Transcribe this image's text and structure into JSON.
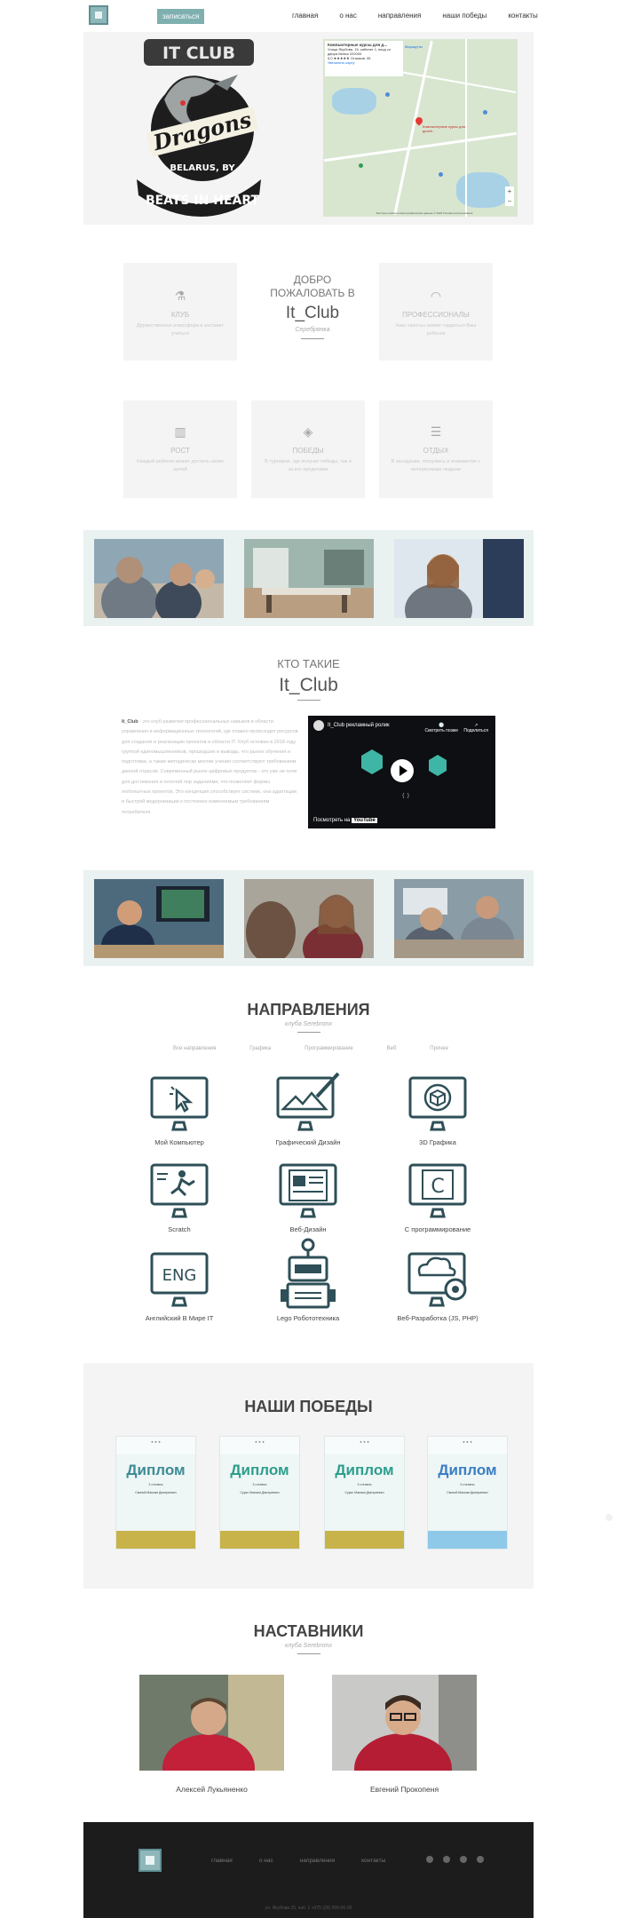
{
  "header": {
    "signup_label": "записаться",
    "nav": [
      "главная",
      "о нас",
      "направления",
      "наши победы",
      "контакты"
    ]
  },
  "badge": {
    "top_text": "IT CLUB",
    "middle_text": "Dragons",
    "country": "BELARUS, BY",
    "bottom_text": "BEATS IN HEART"
  },
  "map": {
    "place_name": "Компьютерные курсы для д...",
    "address": "Улица Якубова, 15, кабинет 1, вход со двора Минск 220000",
    "rating": "5,0 ★★★★★ Отзывов: 35",
    "bigger_map": "Увеличить карту",
    "route_label": "Маршруты",
    "pin_label": "Компьютерные курсы для детей...",
    "footer_text": "Быстрые клавиши  Картографические данные © 2023  Условия использования"
  },
  "features": [
    {
      "icon": "chemistry-icon",
      "title": "КЛУБ",
      "desc": "Дружественная атмосфера в заставит учиться"
    },
    {
      "icon": "speedometer-icon",
      "title": "ПРОФЕССИОНАЛЫ",
      "desc": "Наш «вахты» может гордиться Ваш ребенок"
    },
    {
      "icon": "chart-icon",
      "title": "РОСТ",
      "desc": "Каждый ребенок может достичь своих целей"
    },
    {
      "icon": "layers-icon",
      "title": "ПОБЕДЫ",
      "desc": "В турнирах, где получат победы, так и за его пределами"
    },
    {
      "icon": "database-icon",
      "title": "ОТДЫХ",
      "desc": "В заседании, погружись в знакомство с интересными людьми"
    }
  ],
  "welcome": {
    "line1": "ДОБРО ПОЖАЛОВАТЬ В",
    "line2": "It_Club",
    "line3": "Серебрянка"
  },
  "about": {
    "heading": "КТО ТАКИЕ",
    "title": "It_Club",
    "brand": "It_Club",
    "text": " - это клуб развития профессиональных навыков в области управления и информационных технологий, где плавно происходит ресурсов для создания и реализации проектов в области IT. Клуб основан в 2018 году группой единомышленников, прошедших и выводы, что рынок обучения и подготовки, а также методически многие учения соответствуют требованиям данной отрасли. Современный рынок цифровых продуктов - это уже не поле для достижения и плотной пор заданиями, что позволяет формы любопытных проектов. Это концепция способствует системе, она адаптации и быстрой модернизации к постоянно изменяемым требованиям потребителя.",
    "video_title": "It_Club рекламный ролик",
    "video_later": "Смотреть позже",
    "video_share": "Поделиться",
    "video_watch_on": "Посмотреть на",
    "video_youtube": "YouTube"
  },
  "directions": {
    "title": "НАПРАВЛЕНИЯ",
    "subtitle": "клуба Serebronx",
    "filters": [
      "Все направления",
      "Графика",
      "Программирование",
      "Веб",
      "Прочее"
    ],
    "items": [
      {
        "label": "Мой Компьютер",
        "icon": "computer-cursor-icon"
      },
      {
        "label": "Графический Дизайн",
        "icon": "graphic-design-icon"
      },
      {
        "label": "3D Графика",
        "icon": "3d-cube-icon"
      },
      {
        "label": "Scratch",
        "icon": "scratch-icon"
      },
      {
        "label": "Веб-Дизайн",
        "icon": "web-design-icon"
      },
      {
        "label": "С программирование",
        "icon": "c-language-icon"
      },
      {
        "label": "Английский В Мире IT",
        "icon": "english-icon"
      },
      {
        "label": "Lego Робототехника",
        "icon": "robot-icon"
      },
      {
        "label": "Веб-Разработка (JS, PHP)",
        "icon": "cloud-gear-icon"
      }
    ]
  },
  "wins": {
    "title": "НАШИ ПОБЕДЫ",
    "diplomas": [
      {
        "word": "Диплом",
        "degree": "2 степени",
        "name": "Свиной Максим Дмитриевич"
      },
      {
        "word": "Диплом",
        "degree": "3 степени",
        "name": "Сурко Максим Дмитриевич"
      },
      {
        "word": "Диплом",
        "degree": "3 степени",
        "name": "Сурко Максим Дмитриевич"
      },
      {
        "word": "Диплом",
        "degree": "II степени",
        "name": "Свиной Максим Дмитриевич"
      }
    ]
  },
  "mentors": {
    "title": "НАСТАВНИКИ",
    "subtitle": "клуба Serebronx",
    "people": [
      "Алексей Лукьяненко",
      "Евгений Прокопеня"
    ]
  },
  "footer": {
    "nav": [
      "главная",
      "о нас",
      "направления",
      "контакты"
    ],
    "socials": [
      "facebook-icon",
      "vk-icon",
      "youtube-icon",
      "instagram-icon"
    ],
    "address": "ул. Якубова 15, каб. 1  +375 (29) 000-00-00"
  },
  "colors": {
    "accent": "#7fb0b0",
    "icon_stroke": "#2e4f57",
    "strip_bg": "#eaf1f1",
    "footer_bg": "#1c1c1c"
  }
}
